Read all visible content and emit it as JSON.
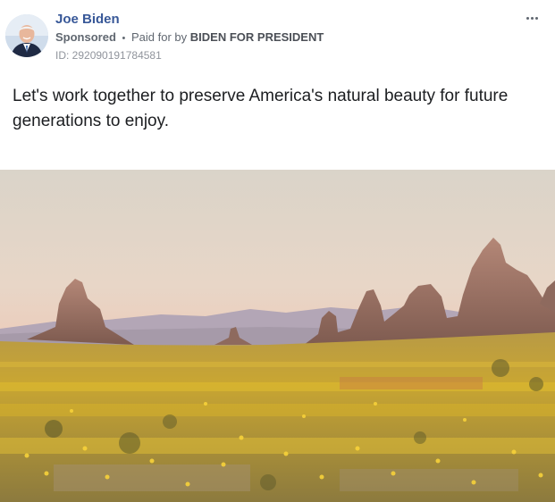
{
  "post": {
    "author": "Joe Biden",
    "sponsored_label": "Sponsored",
    "separator": "•",
    "paid_for_prefix": "Paid for by",
    "paid_for_by": "BIDEN FOR PRESIDENT",
    "ad_id": "ID: 292090191784581",
    "message": "Let's work together to preserve America's natural beauty for future generations to enjoy.",
    "more_icon": "more-horizontal-icon",
    "image": "desert landscape with rock spires and yellow wildflowers"
  },
  "colors": {
    "author_link": "#385898",
    "meta_text": "#606770",
    "id_text": "#90949c",
    "body_text": "#1c1e21"
  }
}
